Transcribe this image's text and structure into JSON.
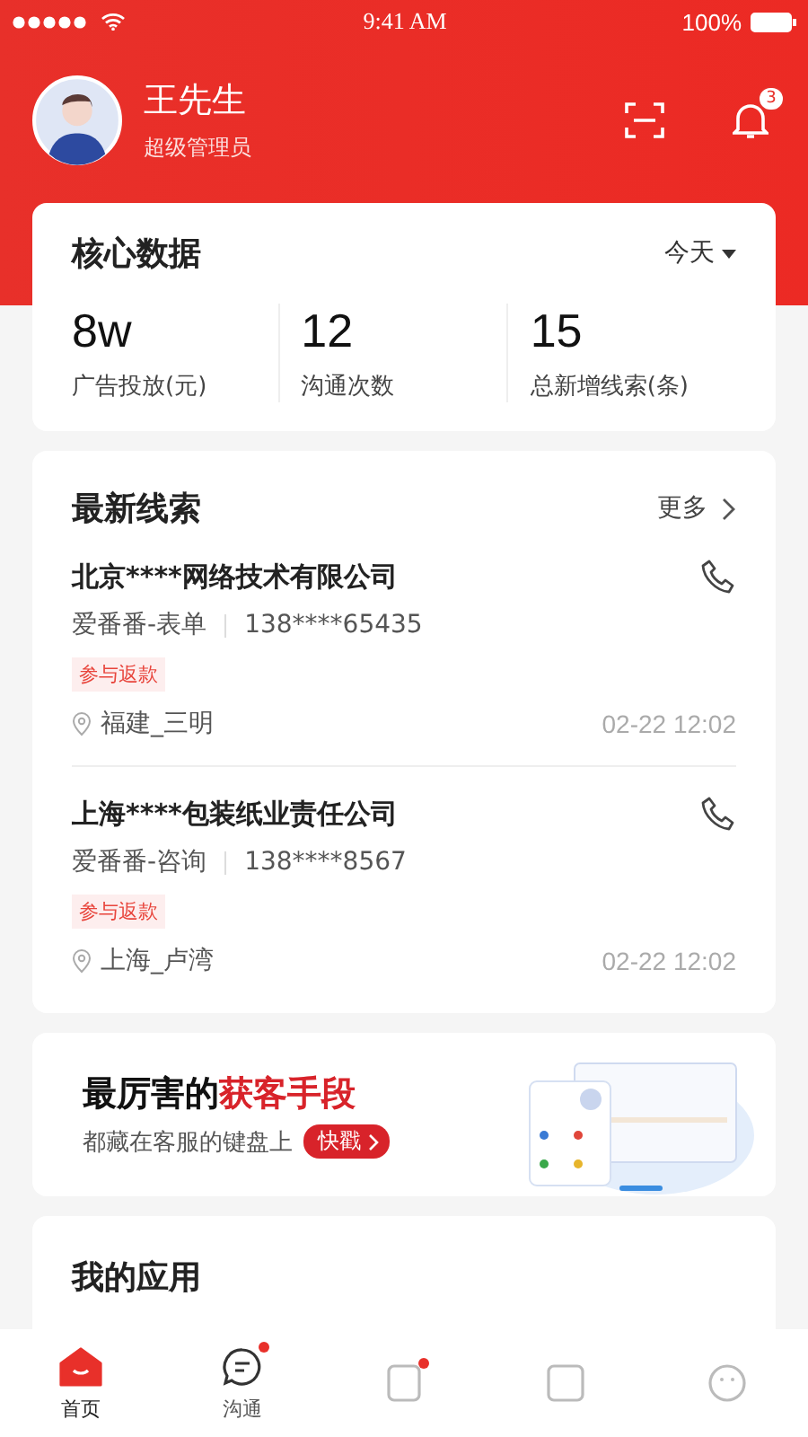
{
  "status_bar": {
    "time": "9:41 AM",
    "battery": "100%"
  },
  "profile": {
    "name": "王先生",
    "role": "超级管理员",
    "notifications": "3"
  },
  "core_data": {
    "title": "核心数据",
    "period": "今天",
    "stats": [
      {
        "value": "8w",
        "label": "广告投放(元)"
      },
      {
        "value": "12",
        "label": "沟通次数"
      },
      {
        "value": "15",
        "label": "总新增线索(条)"
      }
    ]
  },
  "leads": {
    "title": "最新线索",
    "more": "更多",
    "items": [
      {
        "company": "北京****网络技术有限公司",
        "source": "爱番番-表单",
        "phone": "138****65435",
        "tag": "参与返款",
        "location": "福建_三明",
        "time": "02-22 12:02"
      },
      {
        "company": "上海****包装纸业责任公司",
        "source": "爱番番-咨询",
        "phone": "138****8567",
        "tag": "参与返款",
        "location": "上海_卢湾",
        "time": "02-22 12:02"
      }
    ]
  },
  "banner": {
    "title": "最厉害的",
    "highlight": "获客手段",
    "subtitle": "都藏在客服的键盘上",
    "button": "快戳"
  },
  "apps": {
    "title": "我的应用"
  },
  "tabs": [
    {
      "kind": "home",
      "label": "首页",
      "selected": true,
      "dot": false
    },
    {
      "kind": "chat",
      "label": "沟通",
      "selected": false,
      "dot": true
    },
    {
      "kind": "doc",
      "selected": false,
      "dot": true
    },
    {
      "kind": "box",
      "selected": false,
      "dot": false
    },
    {
      "kind": "face",
      "selected": false,
      "dot": false
    }
  ]
}
